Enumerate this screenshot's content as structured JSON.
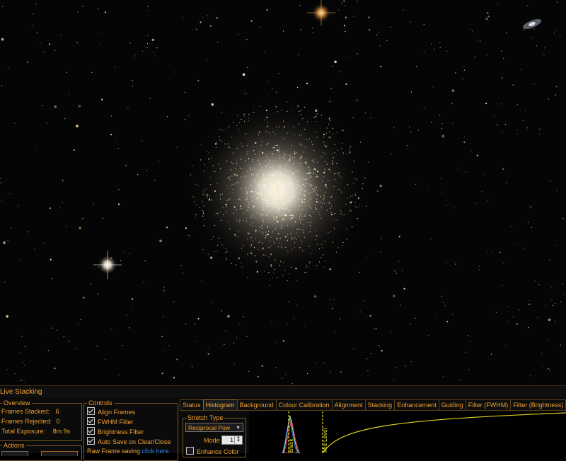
{
  "panel": {
    "title": "Live Stacking"
  },
  "overview": {
    "legend": "Overview",
    "frames_stacked_label": "Frames Stacked:",
    "frames_stacked_value": "6",
    "frames_rejected_label": "Frames Rejected:",
    "frames_rejected_value": "0",
    "total_exposure_label": "Total Exposure:",
    "total_exposure_value": "8m 9s"
  },
  "actions": {
    "legend": "Actions"
  },
  "controls": {
    "legend": "Controls",
    "options": [
      {
        "label": "Align Frames",
        "checked": true
      },
      {
        "label": "FWHM Filter",
        "checked": true
      },
      {
        "label": "Brightness Filter",
        "checked": true
      },
      {
        "label": "Auto Save on Clear/Close",
        "checked": true
      }
    ],
    "raw_frame_label": "Raw Frame saving",
    "raw_frame_link": "click here"
  },
  "tabs": [
    {
      "label": "Status",
      "active": false
    },
    {
      "label": "Histogram",
      "active": true
    },
    {
      "label": "Background",
      "active": false
    },
    {
      "label": "Colour Calibration",
      "active": false
    },
    {
      "label": "Alignment",
      "active": false
    },
    {
      "label": "Stacking",
      "active": false
    },
    {
      "label": "Enhancement",
      "active": false
    },
    {
      "label": "Guiding",
      "active": false
    },
    {
      "label": "Filter (FWHM)",
      "active": false
    },
    {
      "label": "Filter (Brightness)",
      "active": false
    }
  ],
  "histogram": {
    "stretch_legend": "Stretch Type",
    "stretch_value": "Reciprocal Pow",
    "mode_label": "Mode",
    "mode_value": "1",
    "enhance_color_label": "Enhance Color",
    "enhance_color_checked": false,
    "black_marker_label": "Black",
    "mid_marker_label": "Mid Level",
    "curve_color": "#e0d020",
    "marker_color": "#e8e020"
  }
}
